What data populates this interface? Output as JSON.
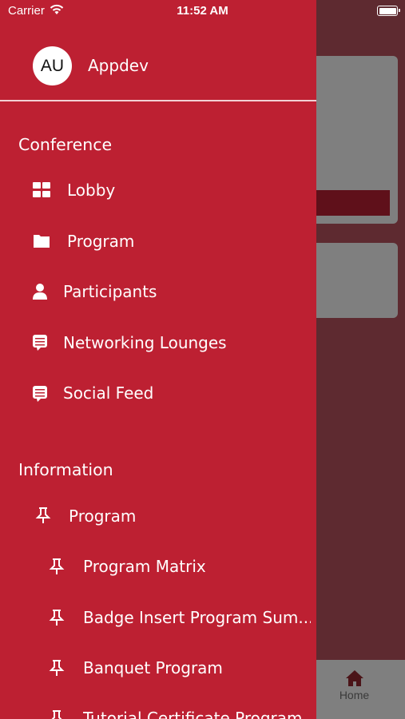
{
  "status_bar": {
    "carrier": "Carrier",
    "time": "11:52 AM"
  },
  "drawer": {
    "avatar_initials": "AU",
    "user_name": "Appdev",
    "sections": [
      {
        "title": "Conference",
        "items": [
          {
            "label": "Lobby",
            "icon": "grid-icon"
          },
          {
            "label": "Program",
            "icon": "folder-icon"
          },
          {
            "label": "Participants",
            "icon": "person-icon"
          },
          {
            "label": "Networking Lounges",
            "icon": "chat-icon"
          },
          {
            "label": "Social Feed",
            "icon": "chat-icon"
          }
        ]
      },
      {
        "title": "Information",
        "items": [
          {
            "label": "Program",
            "icon": "pin-icon"
          },
          {
            "label": "Program Matrix",
            "icon": "pin-icon"
          },
          {
            "label": "Badge Insert Program Sum...",
            "icon": "pin-icon"
          },
          {
            "label": "Banquet Program",
            "icon": "pin-icon"
          },
          {
            "label": "Tutorial Certificate Program",
            "icon": "pin-icon"
          }
        ]
      }
    ]
  },
  "tab_bar": {
    "home_label": "Home"
  },
  "colors": {
    "drawer_bg": "#bd2032",
    "overlay_bg": "#5e2a30",
    "divider": "#f3d0d4"
  }
}
